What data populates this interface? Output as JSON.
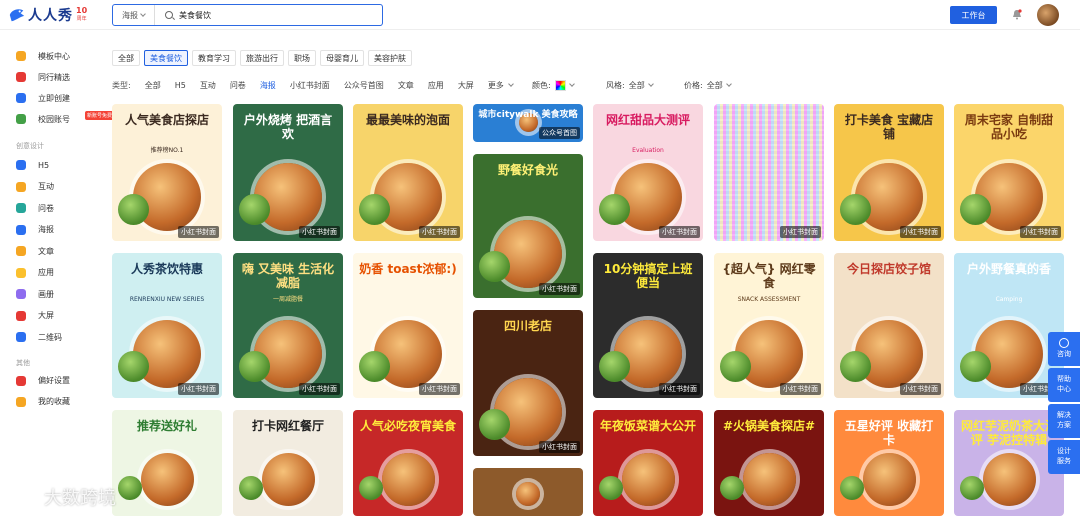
{
  "header": {
    "brand": "人人秀",
    "badge_top": "10",
    "badge_bottom": "周年",
    "search_type": "海报",
    "search_value": "美食餐饮",
    "workbench": "工作台"
  },
  "sidebar": {
    "top_items": [
      {
        "label": "模板中心",
        "icon": "template-icon",
        "color": "#f5a623"
      },
      {
        "label": "同行精选",
        "icon": "peer-icon",
        "color": "#e53935"
      },
      {
        "label": "立即创建",
        "icon": "create-icon",
        "color": "#2b6ff0"
      },
      {
        "label": "校园账号",
        "icon": "campus-icon",
        "color": "#43a047"
      }
    ],
    "new_badge": "新账号免费",
    "section_create": "创意设计",
    "create_items": [
      {
        "label": "H5",
        "icon": "h5-icon",
        "color": "#2b6ff0"
      },
      {
        "label": "互动",
        "icon": "interact-icon",
        "color": "#f5a623"
      },
      {
        "label": "问卷",
        "icon": "survey-icon",
        "color": "#26a69a"
      },
      {
        "label": "海报",
        "icon": "poster-icon",
        "color": "#2b6ff0"
      },
      {
        "label": "文章",
        "icon": "article-icon",
        "color": "#f5a623"
      },
      {
        "label": "应用",
        "icon": "app-icon",
        "color": "#fbc02d"
      },
      {
        "label": "画册",
        "icon": "album-icon",
        "color": "#8e6cef"
      },
      {
        "label": "大屏",
        "icon": "screen-icon",
        "color": "#e53935"
      },
      {
        "label": "二维码",
        "icon": "qrcode-icon",
        "color": "#2b6ff0"
      }
    ],
    "section_other": "其他",
    "other_items": [
      {
        "label": "偏好设置",
        "icon": "heart-icon",
        "color": "#e53935"
      },
      {
        "label": "我的收藏",
        "icon": "star-icon",
        "color": "#f5a623"
      }
    ]
  },
  "categories": [
    "全部",
    "美食餐饮",
    "教育学习",
    "旅游出行",
    "职场",
    "母婴育儿",
    "美容护肤"
  ],
  "active_category": 1,
  "filters": {
    "type_label": "类型:",
    "types": [
      "全部",
      "H5",
      "互动",
      "问卷",
      "海报",
      "小红书封面",
      "公众号首图",
      "文章",
      "应用",
      "大屏",
      "更多"
    ],
    "active_type": 4,
    "color_label": "颜色:",
    "style_label": "风格:",
    "style_value": "全部",
    "price_label": "价格:",
    "price_value": "全部"
  },
  "cards": [
    {
      "title": "人气美食店探店",
      "sub": "推荐榜NO.1",
      "tag": "小红书封面",
      "bg": "#fdf1d8",
      "accent": "#3b2a20"
    },
    {
      "title": "户外烧烤 把酒言欢",
      "sub": "",
      "tag": "小红书封面",
      "bg": "#2f6b46",
      "accent": "#ffffff"
    },
    {
      "title": "最最美味的泡面",
      "sub": "",
      "tag": "小红书封面",
      "bg": "#f7d46a",
      "accent": "#3b2a20"
    },
    {
      "title": "城市citywalk 美食攻略",
      "sub": "",
      "tag": "公众号首图",
      "bg": "#2a7fd4",
      "accent": "#ffffff"
    },
    {
      "title": "网红甜品大测评",
      "sub": "Evaluation",
      "tag": "小红书封面",
      "bg": "#f9d7e0",
      "accent": "#d81b60"
    },
    {
      "title": "",
      "sub": "",
      "tag": "小红书封面",
      "bg": "#eadcf3",
      "accent": "#333333"
    },
    {
      "title": "打卡美食 宝藏店铺",
      "sub": "",
      "tag": "小红书封面",
      "bg": "#f6c64a",
      "accent": "#3b2a20"
    },
    {
      "title": "周末宅家 自制甜品小吃",
      "sub": "",
      "tag": "小红书封面",
      "bg": "#fbd56a",
      "accent": "#7a3b10"
    },
    {
      "title": "野餐好食光",
      "sub": "",
      "tag": "小红书封面",
      "bg": "#3a6f2e",
      "accent": "#fff176"
    },
    {
      "title": "人秀茶饮特惠",
      "sub": "RENRENXIU NEW SERIES",
      "tag": "小红书封面",
      "bg": "#cfeff1",
      "accent": "#1b3a5a"
    },
    {
      "title": "嗨 又美味 生活化减脂",
      "sub": "一周减脂餐",
      "tag": "小红书封面",
      "bg": "#2f6b46",
      "accent": "#ffe082"
    },
    {
      "title": "奶香 toast浓郁:)",
      "sub": "",
      "tag": "小红书封面",
      "bg": "#fff8e6",
      "accent": "#e65100"
    },
    {
      "title": "四川老店",
      "sub": "",
      "tag": "小红书封面",
      "bg": "#4a2412",
      "accent": "#ffd54f"
    },
    {
      "title": "10分钟搞定上班便当",
      "sub": "",
      "tag": "小红书封面",
      "bg": "#2c2c2c",
      "accent": "#ffeb3b"
    },
    {
      "title": "{超人气} 网红零食",
      "sub": "SNACK ASSESSMENT",
      "tag": "小红书封面",
      "bg": "#fff4d6",
      "accent": "#5d3a1a"
    },
    {
      "title": "今日探店饺子馆",
      "sub": "",
      "tag": "小红书封面",
      "bg": "#f3e1c8",
      "accent": "#c0392b"
    },
    {
      "title": "户外野餐真的香",
      "sub": "Camping",
      "tag": "小红书封面",
      "bg": "#bfe6f5",
      "accent": "#ffffff"
    },
    {
      "title": "推荐送好礼",
      "sub": "",
      "tag": "",
      "bg": "#eef6e4",
      "accent": "#2e7d32"
    },
    {
      "title": "打卡网红餐厅",
      "sub": "",
      "tag": "",
      "bg": "#f2ece0",
      "accent": "#222222"
    },
    {
      "title": "人气必吃夜宵美食",
      "sub": "",
      "tag": "",
      "bg": "#c62828",
      "accent": "#ffeb3b"
    },
    {
      "title": "",
      "sub": "",
      "tag": "",
      "bg": "#8d5a2b",
      "accent": "#ffffff"
    },
    {
      "title": "年夜饭菜谱大公开",
      "sub": "",
      "tag": "",
      "bg": "#b71c1c",
      "accent": "#ffeb3b"
    },
    {
      "title": "#火锅美食探店#",
      "sub": "",
      "tag": "",
      "bg": "#7a1410",
      "accent": "#ffeb3b"
    },
    {
      "title": "五星好评 收藏打卡",
      "sub": "",
      "tag": "",
      "bg": "#ff8a3d",
      "accent": "#ffffff"
    },
    {
      "title": "网红芋泥奶茶大测评 芋泥控特辑",
      "sub": "",
      "tag": "",
      "bg": "#c9b3e8",
      "accent": "#ffeb3b"
    }
  ],
  "float_help": [
    {
      "label": "咨询",
      "icon": "chat-icon"
    },
    {
      "label": "帮助中心",
      "icon": ""
    },
    {
      "label": "解决方案",
      "icon": ""
    },
    {
      "label": "设计服务",
      "icon": ""
    }
  ],
  "watermark": "大数跨境"
}
